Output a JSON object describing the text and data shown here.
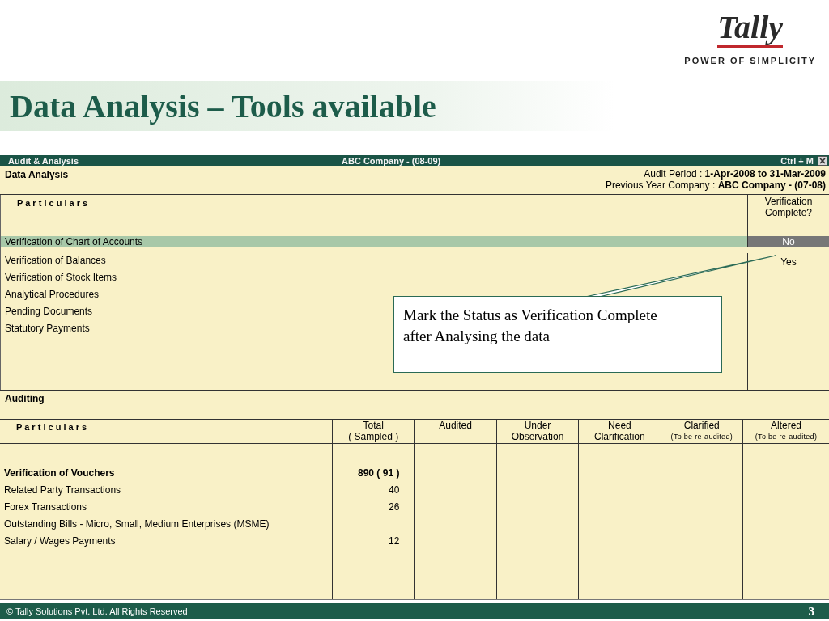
{
  "logo": {
    "wordmark": "Tally",
    "tagline": "POWER OF SIMPLICITY"
  },
  "slide_title": "Data Analysis – Tools available",
  "window": {
    "title_bar": {
      "left": "Audit & Analysis",
      "center": "ABC Company - (08-09)",
      "shortcut": "Ctrl + M"
    },
    "section": "Data Analysis",
    "audit_period": {
      "label": "Audit Period :",
      "value": "1-Apr-2008 to 31-Mar-2009"
    },
    "previous_year": {
      "label": "Previous Year Company :",
      "value": "ABC Company - (07-08)"
    },
    "verification_table": {
      "columns": [
        "P a r t i c u l a r s",
        "Verification Complete?"
      ],
      "rows": [
        {
          "particular": "Verification of Chart of Accounts",
          "status": "No",
          "selected": true
        },
        {
          "particular": "Verification of Balances",
          "status": "Yes",
          "selected": false
        },
        {
          "particular": "Verification of Stock Items",
          "selected": false
        },
        {
          "particular": "Analytical Procedures",
          "selected": false
        },
        {
          "particular": "Pending Documents",
          "selected": false
        },
        {
          "particular": "Statutory Payments",
          "selected": false
        }
      ]
    },
    "auditing": {
      "title": "Auditing",
      "columns": [
        {
          "label": "P a r t i c u l a r s"
        },
        {
          "label": "Total",
          "sublabel": "( Sampled )"
        },
        {
          "label": "Audited"
        },
        {
          "label": "Under",
          "sublabel": "Observation"
        },
        {
          "label": "Need",
          "sublabel": "Clarification"
        },
        {
          "label": "Clarified",
          "note": "(To be re-audited)"
        },
        {
          "label": "Altered",
          "note": "(To be re-audited)"
        }
      ],
      "rows": [
        {
          "kind": "group",
          "particular": "Verification of Vouchers",
          "total": "890 ( 91 )"
        },
        {
          "kind": "item",
          "particular": "Related Party Transactions",
          "total": "40"
        },
        {
          "kind": "item",
          "particular": "Forex Transactions",
          "total": "26"
        },
        {
          "kind": "item",
          "particular": "Outstanding Bills - Micro, Small, Medium Enterprises (MSME)"
        },
        {
          "kind": "item",
          "particular": "Salary / Wages Payments",
          "total": "12"
        }
      ]
    }
  },
  "callout": "Mark the Status as Verification Complete after Analysing the data",
  "footer": {
    "copyright": "© Tally Solutions Pvt. Ltd. All Rights Reserved",
    "page": "3"
  }
}
